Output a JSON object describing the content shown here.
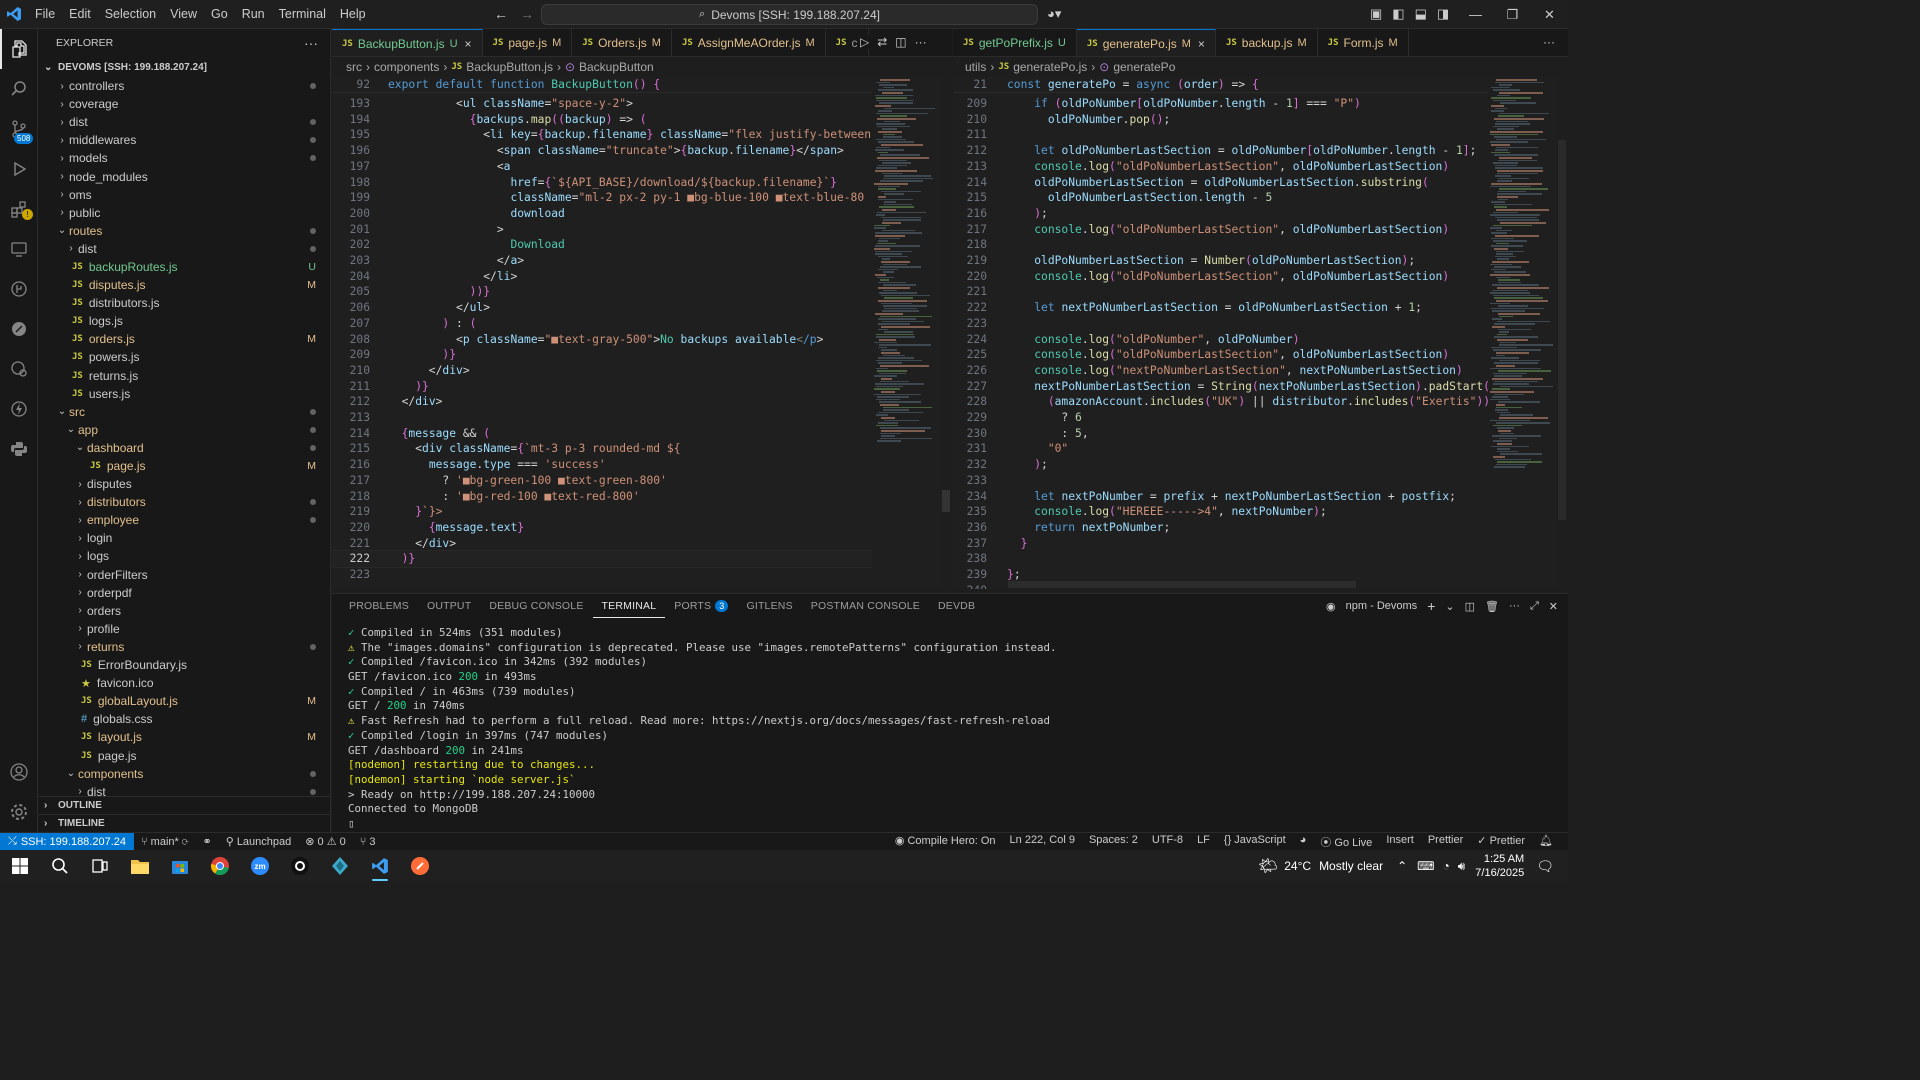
{
  "titlebar": {
    "menu": [
      "File",
      "Edit",
      "Selection",
      "View",
      "Go",
      "Run",
      "Terminal",
      "Help"
    ],
    "command_center": "Devoms [SSH: 199.188.207.24]"
  },
  "activity": {
    "scm_badge": "508"
  },
  "sidebar": {
    "title": "EXPLORER",
    "root": "DEVOMS [SSH: 199.188.207.24]",
    "items": [
      {
        "label": "controllers",
        "type": "folder",
        "indent": 1,
        "open": false,
        "deco": "dot"
      },
      {
        "label": "coverage",
        "type": "folder",
        "indent": 1,
        "open": false,
        "deco": ""
      },
      {
        "label": "dist",
        "type": "folder",
        "indent": 1,
        "open": false,
        "deco": "dot"
      },
      {
        "label": "middlewares",
        "type": "folder",
        "indent": 1,
        "open": false,
        "deco": "dot"
      },
      {
        "label": "models",
        "type": "folder",
        "indent": 1,
        "open": false,
        "deco": "dot"
      },
      {
        "label": "node_modules",
        "type": "folder",
        "indent": 1,
        "open": false,
        "deco": ""
      },
      {
        "label": "oms",
        "type": "folder",
        "indent": 1,
        "open": false,
        "deco": ""
      },
      {
        "label": "public",
        "type": "folder",
        "indent": 1,
        "open": false,
        "deco": ""
      },
      {
        "label": "routes",
        "type": "folder",
        "indent": 1,
        "open": true,
        "deco": "dot",
        "color": "mod"
      },
      {
        "label": "dist",
        "type": "folder",
        "indent": 2,
        "open": false,
        "deco": "dot"
      },
      {
        "label": "backupRoutes.js",
        "type": "js",
        "indent": 2,
        "deco": "U",
        "color": "unt"
      },
      {
        "label": "disputes.js",
        "type": "js",
        "indent": 2,
        "deco": "M",
        "color": "mod"
      },
      {
        "label": "distributors.js",
        "type": "js",
        "indent": 2,
        "deco": ""
      },
      {
        "label": "logs.js",
        "type": "js",
        "indent": 2,
        "deco": ""
      },
      {
        "label": "orders.js",
        "type": "js",
        "indent": 2,
        "deco": "M",
        "color": "mod"
      },
      {
        "label": "powers.js",
        "type": "js",
        "indent": 2,
        "deco": ""
      },
      {
        "label": "returns.js",
        "type": "js",
        "indent": 2,
        "deco": ""
      },
      {
        "label": "users.js",
        "type": "js",
        "indent": 2,
        "deco": ""
      },
      {
        "label": "src",
        "type": "folder",
        "indent": 1,
        "open": true,
        "deco": "dot",
        "color": "mod"
      },
      {
        "label": "app",
        "type": "folder",
        "indent": 2,
        "open": true,
        "deco": "dot",
        "color": "mod"
      },
      {
        "label": "dashboard",
        "type": "folder",
        "indent": 3,
        "open": true,
        "deco": "dot",
        "color": "mod"
      },
      {
        "label": "page.js",
        "type": "js",
        "indent": 4,
        "deco": "M",
        "color": "mod"
      },
      {
        "label": "disputes",
        "type": "folder",
        "indent": 3,
        "open": false,
        "deco": ""
      },
      {
        "label": "distributors",
        "type": "folder",
        "indent": 3,
        "open": false,
        "deco": "dot",
        "color": "mod"
      },
      {
        "label": "employee",
        "type": "folder",
        "indent": 3,
        "open": false,
        "deco": "dot",
        "color": "mod"
      },
      {
        "label": "login",
        "type": "folder",
        "indent": 3,
        "open": false,
        "deco": ""
      },
      {
        "label": "logs",
        "type": "folder",
        "indent": 3,
        "open": false,
        "deco": ""
      },
      {
        "label": "orderFilters",
        "type": "folder",
        "indent": 3,
        "open": false,
        "deco": ""
      },
      {
        "label": "orderpdf",
        "type": "folder",
        "indent": 3,
        "open": false,
        "deco": ""
      },
      {
        "label": "orders",
        "type": "folder",
        "indent": 3,
        "open": false,
        "deco": ""
      },
      {
        "label": "profile",
        "type": "folder",
        "indent": 3,
        "open": false,
        "deco": ""
      },
      {
        "label": "returns",
        "type": "folder",
        "indent": 3,
        "open": false,
        "deco": "dot",
        "color": "mod"
      },
      {
        "label": "ErrorBoundary.js",
        "type": "js",
        "indent": 3,
        "deco": ""
      },
      {
        "label": "favicon.ico",
        "type": "star",
        "indent": 3,
        "deco": ""
      },
      {
        "label": "globalLayout.js",
        "type": "js",
        "indent": 3,
        "deco": "M",
        "color": "mod"
      },
      {
        "label": "globals.css",
        "type": "css",
        "indent": 3,
        "deco": ""
      },
      {
        "label": "layout.js",
        "type": "js",
        "indent": 3,
        "deco": "M",
        "color": "mod"
      },
      {
        "label": "page.js",
        "type": "js",
        "indent": 3,
        "deco": ""
      },
      {
        "label": "components",
        "type": "folder",
        "indent": 2,
        "open": true,
        "deco": "dot",
        "color": "mod"
      },
      {
        "label": "dist",
        "type": "folder",
        "indent": 3,
        "open": false,
        "deco": "dot"
      }
    ],
    "outline": "OUTLINE",
    "timeline": "TIMELINE"
  },
  "left_editor": {
    "tabs": [
      {
        "label": "BackupButton.js",
        "status": "U",
        "active": true,
        "close": "×"
      },
      {
        "label": "page.js",
        "status": "M"
      },
      {
        "label": "Orders.js",
        "status": "M"
      },
      {
        "label": "AssignMeAOrder.js",
        "status": "M"
      },
      {
        "label": "c",
        "status": ""
      }
    ],
    "breadcrumb": [
      "src",
      "components",
      "BackupButton.js",
      "BackupButton"
    ],
    "sticky": {
      "num": "92",
      "text": "export default function BackupButton() {"
    },
    "current_line": "222",
    "lines": [
      {
        "n": "193",
        "t": "          <ul className=\"space-y-2\">"
      },
      {
        "n": "194",
        "t": "            {backups.map((backup) => ("
      },
      {
        "n": "195",
        "t": "              <li key={backup.filename} className=\"flex justify-between"
      },
      {
        "n": "196",
        "t": "                <span className=\"truncate\">{backup.filename}</span>"
      },
      {
        "n": "197",
        "t": "                <a"
      },
      {
        "n": "198",
        "t": "                  href={`${API_BASE}/download/${backup.filename}`}"
      },
      {
        "n": "199",
        "t": "                  className=\"ml-2 px-2 py-1 ■bg-blue-100 ■text-blue-80"
      },
      {
        "n": "200",
        "t": "                  download"
      },
      {
        "n": "201",
        "t": "                >"
      },
      {
        "n": "202",
        "t": "                  Download"
      },
      {
        "n": "203",
        "t": "                </a>"
      },
      {
        "n": "204",
        "t": "              </li>"
      },
      {
        "n": "205",
        "t": "            ))}"
      },
      {
        "n": "206",
        "t": "          </ul>"
      },
      {
        "n": "207",
        "t": "        ) : ("
      },
      {
        "n": "208",
        "t": "          <p className=\"■text-gray-500\">No backups available</p>"
      },
      {
        "n": "209",
        "t": "        )}"
      },
      {
        "n": "210",
        "t": "      </div>"
      },
      {
        "n": "211",
        "t": "    )}"
      },
      {
        "n": "212",
        "t": "  </div>"
      },
      {
        "n": "213",
        "t": ""
      },
      {
        "n": "214",
        "t": "  {message && ("
      },
      {
        "n": "215",
        "t": "    <div className={`mt-3 p-3 rounded-md ${"
      },
      {
        "n": "216",
        "t": "      message.type === 'success'"
      },
      {
        "n": "217",
        "t": "        ? '■bg-green-100 ■text-green-800'"
      },
      {
        "n": "218",
        "t": "        : '■bg-red-100 ■text-red-800'"
      },
      {
        "n": "219",
        "t": "    }`}>"
      },
      {
        "n": "220",
        "t": "      {message.text}"
      },
      {
        "n": "221",
        "t": "    </div>"
      },
      {
        "n": "222",
        "t": "  )}"
      },
      {
        "n": "223",
        "t": ""
      }
    ]
  },
  "right_editor": {
    "tabs": [
      {
        "label": "getPoPrefix.js",
        "status": "U"
      },
      {
        "label": "generatePo.js",
        "status": "M",
        "active": true,
        "close": "×"
      },
      {
        "label": "backup.js",
        "status": "M"
      },
      {
        "label": "Form.js",
        "status": "M"
      }
    ],
    "breadcrumb": [
      "utils",
      "generatePo.js",
      "generatePo"
    ],
    "sticky": {
      "num": "21",
      "text": "const generatePo = async (order) => {"
    },
    "lines": [
      {
        "n": "209",
        "t": "    if (oldPoNumber[oldPoNumber.length - 1] === \"P\")"
      },
      {
        "n": "210",
        "t": "      oldPoNumber.pop();"
      },
      {
        "n": "211",
        "t": ""
      },
      {
        "n": "212",
        "t": "    let oldPoNumberLastSection = oldPoNumber[oldPoNumber.length - 1];"
      },
      {
        "n": "213",
        "t": "    console.log(\"oldPoNumberLastSection\", oldPoNumberLastSection)"
      },
      {
        "n": "214",
        "t": "    oldPoNumberLastSection = oldPoNumberLastSection.substring("
      },
      {
        "n": "215",
        "t": "      oldPoNumberLastSection.length - 5"
      },
      {
        "n": "216",
        "t": "    );"
      },
      {
        "n": "217",
        "t": "    console.log(\"oldPoNumberLastSection\", oldPoNumberLastSection)"
      },
      {
        "n": "218",
        "t": ""
      },
      {
        "n": "219",
        "t": "    oldPoNumberLastSection = Number(oldPoNumberLastSection);"
      },
      {
        "n": "220",
        "t": "    console.log(\"oldPoNumberLastSection\", oldPoNumberLastSection)"
      },
      {
        "n": "221",
        "t": ""
      },
      {
        "n": "222",
        "t": "    let nextPoNumberLastSection = oldPoNumberLastSection + 1;"
      },
      {
        "n": "223",
        "t": ""
      },
      {
        "n": "224",
        "t": "    console.log(\"oldPoNumber\", oldPoNumber)"
      },
      {
        "n": "225",
        "t": "    console.log(\"oldPoNumberLastSection\", oldPoNumberLastSection)"
      },
      {
        "n": "226",
        "t": "    console.log(\"nextPoNumberLastSection\", nextPoNumberLastSection)"
      },
      {
        "n": "227",
        "t": "    nextPoNumberLastSection = String(nextPoNumberLastSection).padStart("
      },
      {
        "n": "228",
        "t": "      (amazonAccount.includes(\"UK\") || distributor.includes(\"Exertis\"))"
      },
      {
        "n": "229",
        "t": "        ? 6"
      },
      {
        "n": "230",
        "t": "        : 5,"
      },
      {
        "n": "231",
        "t": "      \"0\""
      },
      {
        "n": "232",
        "t": "    );"
      },
      {
        "n": "233",
        "t": ""
      },
      {
        "n": "234",
        "t": "    let nextPoNumber = prefix + nextPoNumberLastSection + postfix;"
      },
      {
        "n": "235",
        "t": "    console.log(\"HEREEE----->4\", nextPoNumber);"
      },
      {
        "n": "236",
        "t": "    return nextPoNumber;"
      },
      {
        "n": "237",
        "t": "  }"
      },
      {
        "n": "238",
        "t": ""
      },
      {
        "n": "239",
        "t": "};"
      },
      {
        "n": "240",
        "t": ""
      }
    ]
  },
  "panel": {
    "tabs": [
      {
        "label": "PROBLEMS"
      },
      {
        "label": "OUTPUT"
      },
      {
        "label": "DEBUG CONSOLE"
      },
      {
        "label": "TERMINAL",
        "active": true
      },
      {
        "label": "PORTS",
        "badge": "3"
      },
      {
        "label": "GITLENS"
      },
      {
        "label": "POSTMAN CONSOLE"
      },
      {
        "label": "DEVDB"
      }
    ],
    "terminal_name": "npm - Devoms",
    "lines": [
      {
        "icon": "✓",
        "kind": "ok",
        "text": "Compiled in 524ms (351 modules)"
      },
      {
        "icon": "⚠",
        "kind": "warn",
        "text": "The \"images.domains\" configuration is deprecated. Please use \"images.remotePatterns\" configuration instead."
      },
      {
        "icon": "✓",
        "kind": "ok",
        "text": "Compiled /favicon.ico in 342ms (392 modules)"
      },
      {
        "icon": "",
        "kind": "get",
        "pre": "GET /favicon.ico ",
        "code": "200",
        "post": " in 493ms"
      },
      {
        "icon": "✓",
        "kind": "ok",
        "text": "Compiled / in 463ms (739 modules)"
      },
      {
        "icon": "",
        "kind": "get",
        "pre": "GET / ",
        "code": "200",
        "post": " in 740ms"
      },
      {
        "icon": "⚠",
        "kind": "warn",
        "text": "Fast Refresh had to perform a full reload. Read more: https://nextjs.org/docs/messages/fast-refresh-reload"
      },
      {
        "icon": "✓",
        "kind": "ok",
        "text": "Compiled /login in 397ms (747 modules)"
      },
      {
        "icon": "",
        "kind": "get",
        "pre": "GET /dashboard ",
        "code": "200",
        "post": " in 241ms"
      },
      {
        "icon": "",
        "kind": "nodemon",
        "text": "[nodemon] restarting due to changes..."
      },
      {
        "icon": "",
        "kind": "nodemon",
        "text": "[nodemon] starting `node server.js`"
      },
      {
        "icon": "",
        "kind": "plain",
        "text": "> Ready on http://199.188.207.24:10000"
      },
      {
        "icon": "",
        "kind": "plain",
        "text": "Connected to MongoDB"
      },
      {
        "icon": "",
        "kind": "cursor",
        "text": "▯"
      }
    ]
  },
  "statusbar": {
    "remote": "SSH: 199.188.207.24",
    "branch": "main*",
    "launchpad": "Launchpad",
    "errors": "⊗ 0 ⚠ 0",
    "ports": "⑂ 3",
    "compile_hero": "Compile Hero: On",
    "position": "Ln 222, Col 9",
    "spaces": "Spaces: 2",
    "encoding": "UTF-8",
    "eol": "LF",
    "language": "{} JavaScript",
    "golive": "Go Live",
    "insert": "Insert",
    "prettier1": "Prettier",
    "prettier2": "✓ Prettier"
  },
  "taskbar": {
    "weather_temp": "24°C",
    "weather_desc": "Mostly clear",
    "time": "1:25 AM",
    "date": "7/16/2025"
  }
}
